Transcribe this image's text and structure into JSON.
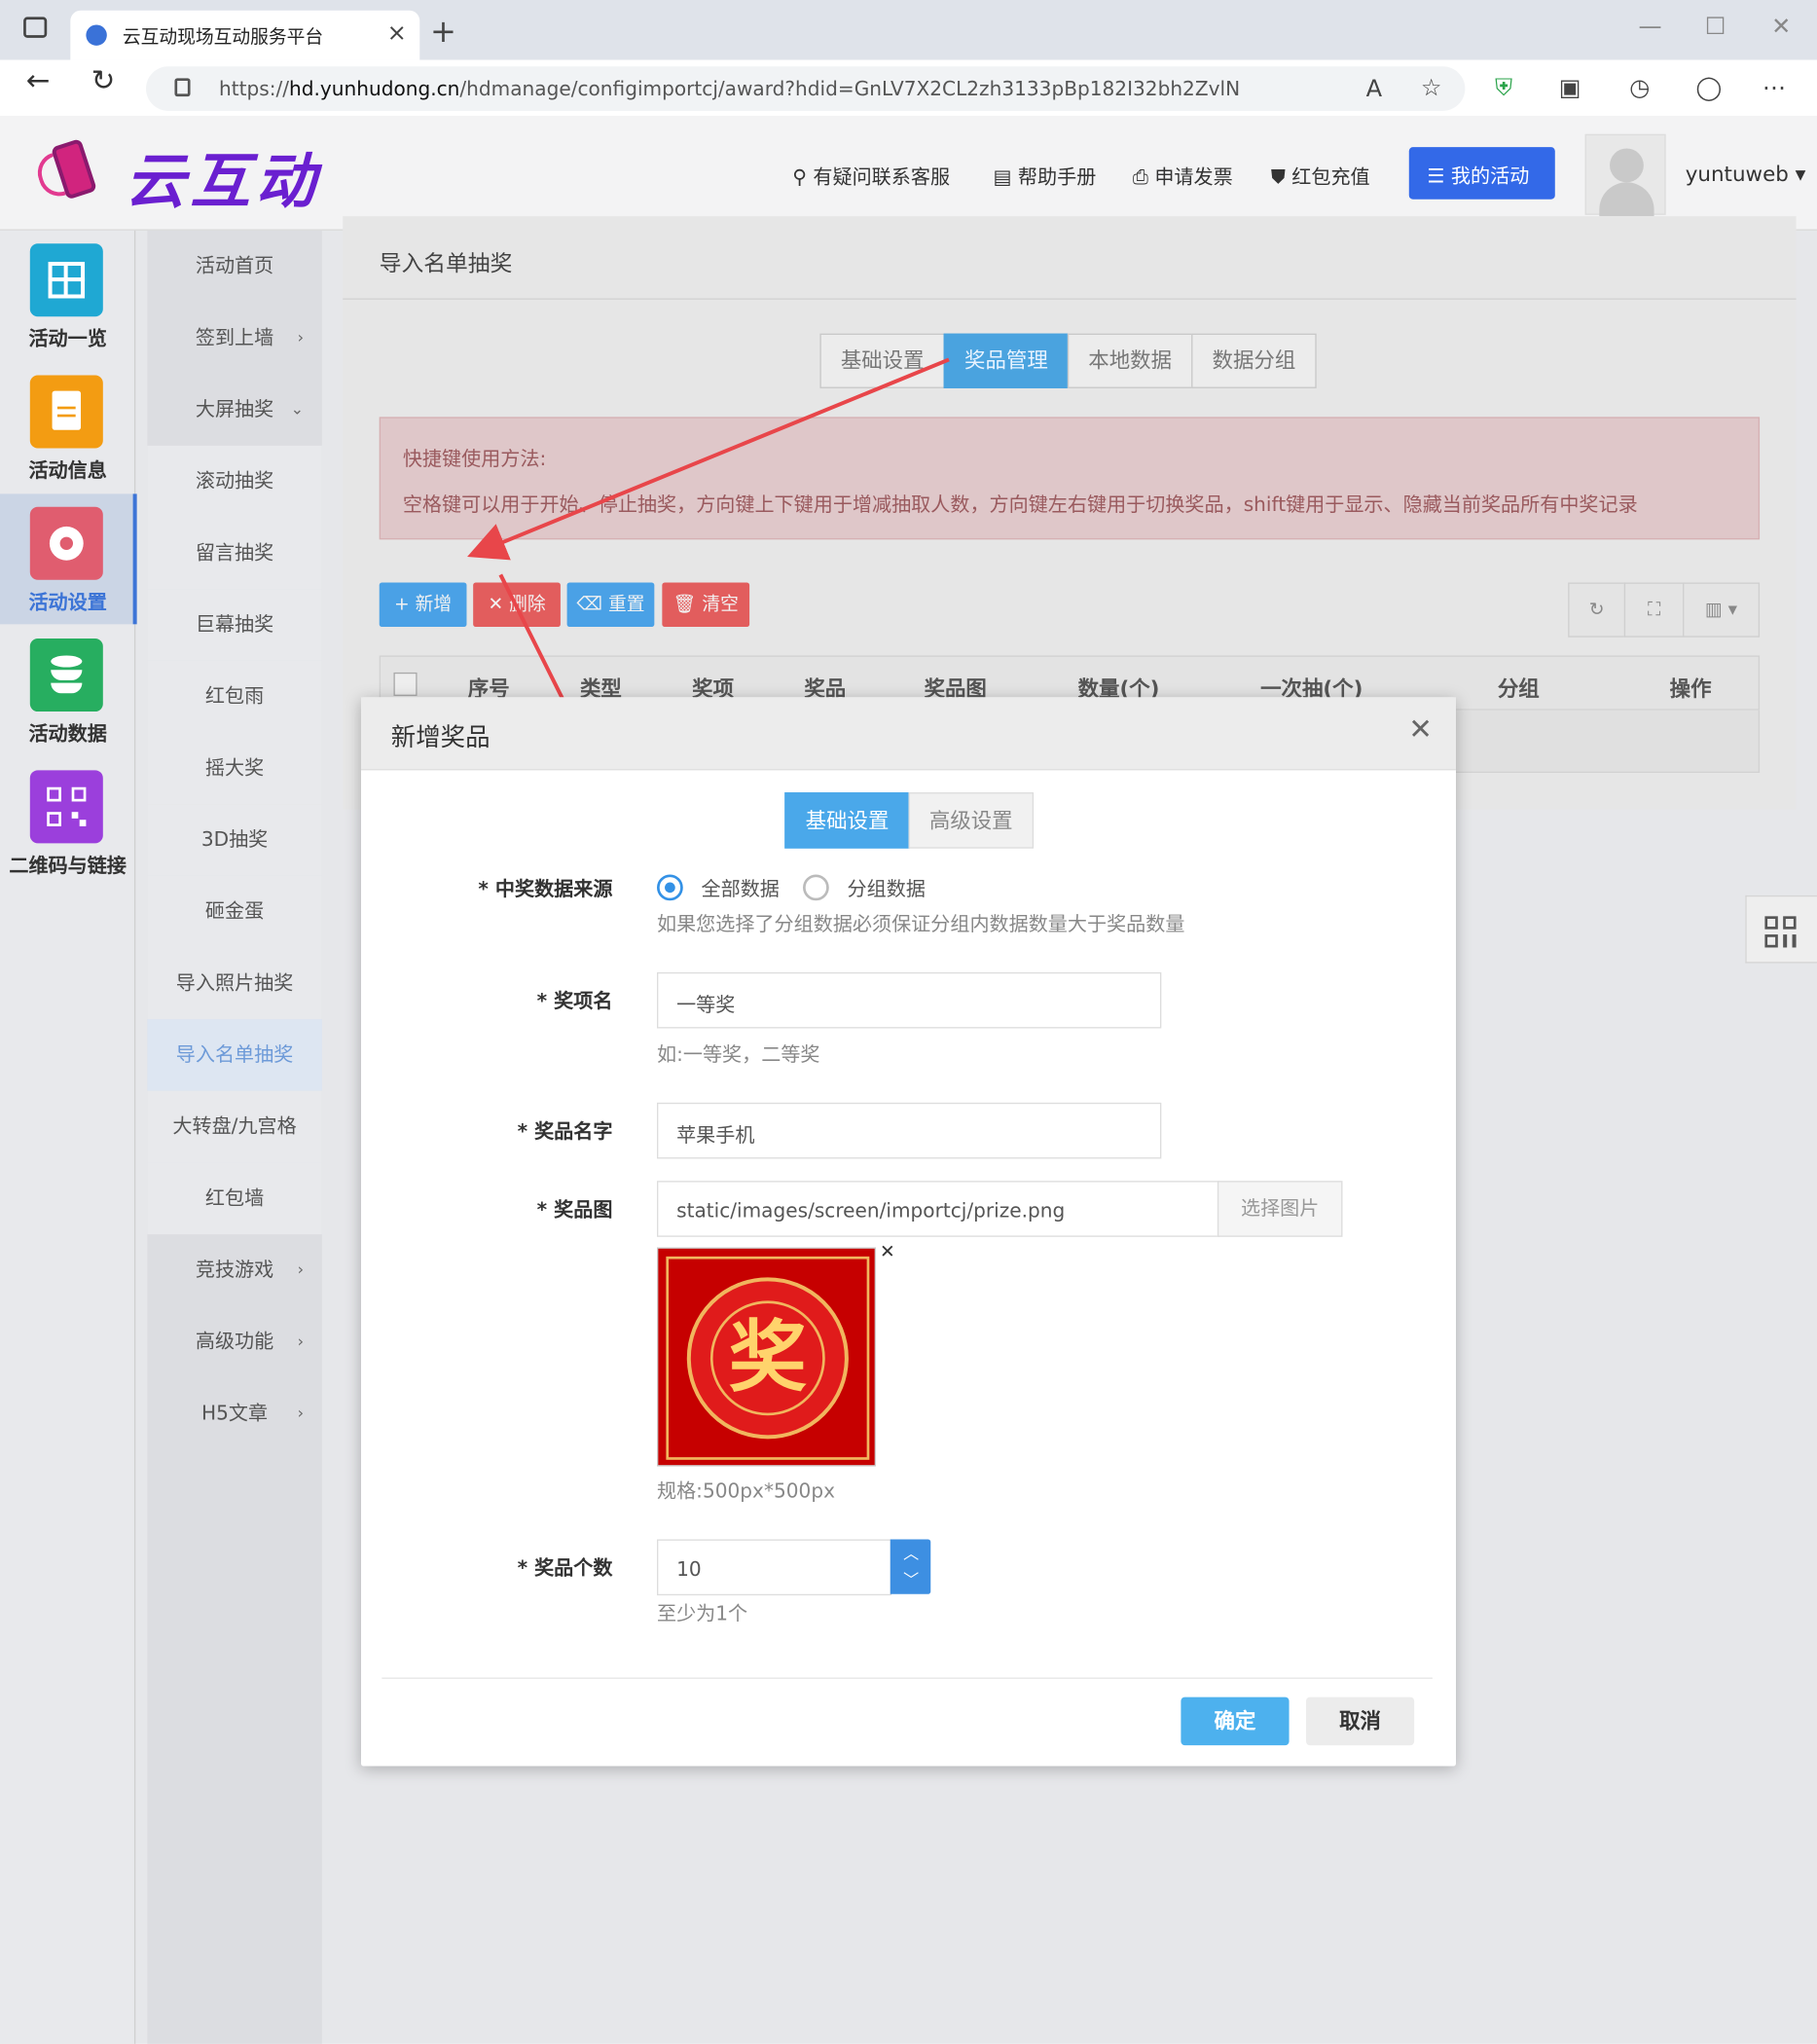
{
  "browser": {
    "tab_title": "云互动现场互动服务平台",
    "url_prefix": "https://",
    "url_host": "hd.yunhudong.cn",
    "url_path": "/hdmanage/configimportcj/award?hdid=GnLV7X2CL2zh3133pBp182I32bh2ZvlN"
  },
  "header": {
    "logo_text": "云互动",
    "links": [
      {
        "icon": "user-plus-icon",
        "label": "有疑问联系客服"
      },
      {
        "icon": "book-icon",
        "label": "帮助手册"
      },
      {
        "icon": "printer-icon",
        "label": "申请发票"
      },
      {
        "icon": "shield-check-icon",
        "label": "红包充值"
      }
    ],
    "my_activity": "我的活动",
    "username": "yuntuweb"
  },
  "sidebar_primary": [
    {
      "label": "活动一览",
      "icon": "grid-icon",
      "color": "#1fa8d3"
    },
    {
      "label": "活动信息",
      "icon": "document-icon",
      "color": "#f39c12"
    },
    {
      "label": "活动设置",
      "icon": "gear-icon",
      "color": "#e05d6f",
      "active": true
    },
    {
      "label": "活动数据",
      "icon": "database-icon",
      "color": "#27ae60"
    },
    {
      "label": "二维码与链接",
      "icon": "qrcode-icon",
      "color": "#9b3fdc"
    }
  ],
  "sidebar_secondary": [
    {
      "label": "活动首页"
    },
    {
      "label": "签到上墙",
      "arrow": "›"
    },
    {
      "label": "大屏抽奖",
      "arrow": "⌄"
    },
    {
      "label": "滚动抽奖"
    },
    {
      "label": "留言抽奖"
    },
    {
      "label": "巨幕抽奖"
    },
    {
      "label": "红包雨"
    },
    {
      "label": "摇大奖"
    },
    {
      "label": "3D抽奖"
    },
    {
      "label": "砸金蛋"
    },
    {
      "label": "导入照片抽奖"
    },
    {
      "label": "导入名单抽奖",
      "active": true
    },
    {
      "label": "大转盘/九宫格"
    },
    {
      "label": "红包墙"
    },
    {
      "label": "竞技游戏",
      "arrow": "›"
    },
    {
      "label": "高级功能",
      "arrow": "›"
    },
    {
      "label": "H5文章",
      "arrow": "›"
    }
  ],
  "main": {
    "title": "导入名单抽奖",
    "tabs": [
      "基础设置",
      "奖品管理",
      "本地数据",
      "数据分组"
    ],
    "active_tab": "奖品管理",
    "alert_title": "快捷键使用方法:",
    "alert_text": "空格键可以用于开始、停止抽奖，方向键上下键用于增减抽取人数，方向键左右键用于切换奖品，shift键用于显示、隐藏当前奖品所有中奖记录",
    "buttons": [
      {
        "label": "+ 新增",
        "color": "#4aa1e6"
      },
      {
        "label": "✕ 删除",
        "color": "#e25d5d"
      },
      {
        "label": "重置",
        "color": "#4aa1e6"
      },
      {
        "label": "清空",
        "color": "#e25d5d"
      }
    ],
    "columns": [
      "序号",
      "类型",
      "奖项",
      "奖品",
      "奖品图",
      "数量(个)",
      "一次抽(个)",
      "分组",
      "操作"
    ]
  },
  "modal": {
    "title": "新增奖品",
    "tabs": [
      "基础设置",
      "高级设置"
    ],
    "source_label": "* 中奖数据来源",
    "source_options": [
      "全部数据",
      "分组数据"
    ],
    "source_hint": "如果您选择了分组数据必须保证分组内数据数量大于奖品数量",
    "award_label": "* 奖项名",
    "award_value": "一等奖",
    "award_hint": "如:一等奖，二等奖",
    "prize_label": "* 奖品名字",
    "prize_value": "苹果手机",
    "image_label": "* 奖品图",
    "image_value": "static/images/screen/importcj/prize.png",
    "image_button": "选择图片",
    "image_char": "奖",
    "image_hint": "规格:500px*500px",
    "count_label": "* 奖品个数",
    "count_value": "10",
    "count_hint": "至少为1个",
    "ok": "确定",
    "cancel": "取消"
  }
}
